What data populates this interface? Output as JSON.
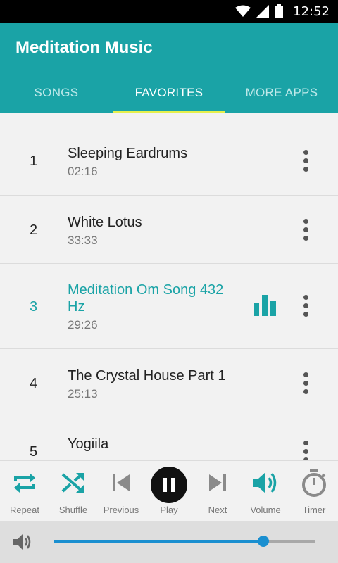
{
  "status_bar": {
    "time": "12:52",
    "icons": [
      "wifi-icon",
      "signal-icon",
      "battery-icon"
    ]
  },
  "app": {
    "title": "Meditation Music",
    "accent_color": "#1aa3a6",
    "indicator_color": "#e6f04c"
  },
  "tabs": [
    {
      "label": "SONGS",
      "active": false
    },
    {
      "label": "FAVORITES",
      "active": true
    },
    {
      "label": "MORE APPS",
      "active": false
    }
  ],
  "songs": [
    {
      "number": "1",
      "title": "Sleeping Eardrums",
      "duration": "02:16"
    },
    {
      "number": "2",
      "title": "White Lotus",
      "duration": "33:33"
    },
    {
      "number": "3",
      "title": "Meditation Om Song 432 Hz",
      "duration": "29:26",
      "playing": true
    },
    {
      "number": "4",
      "title": "The Crystal House Part 1",
      "duration": "25:13"
    },
    {
      "number": "5",
      "title": "Yogiila",
      "duration": ""
    }
  ],
  "controls": {
    "repeat": {
      "label": "Repeat",
      "icon": "repeat-icon"
    },
    "shuffle": {
      "label": "Shuffle",
      "icon": "shuffle-icon"
    },
    "previous": {
      "label": "Previous",
      "icon": "skip-previous-icon"
    },
    "play": {
      "label": "Play",
      "icon": "pause-icon"
    },
    "next": {
      "label": "Next",
      "icon": "skip-next-icon"
    },
    "volume": {
      "label": "Volume",
      "icon": "volume-icon"
    },
    "timer": {
      "label": "Timer",
      "icon": "timer-icon"
    }
  },
  "volume": {
    "level": 0.8,
    "icon": "volume-icon"
  }
}
